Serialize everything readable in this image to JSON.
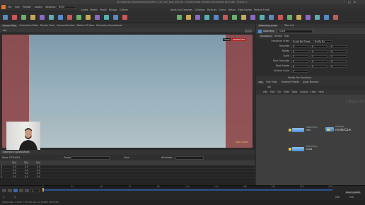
{
  "window": {
    "title": "/ECG/Nordic/Tutorials/Houdini/SHOT_010_040_Rain_v02.hip - Houdini Indie Limited-Commercial 18.0.460 - Python 3"
  },
  "menubar": {
    "items": [
      "File",
      "Edit",
      "Render",
      "Assets",
      "Windows",
      "Help"
    ],
    "desktop": "Build"
  },
  "shelf": {
    "tabs": [
      "Create",
      "Modify",
      "Model",
      "Polygon",
      "Deform",
      "Texture",
      "Rigging",
      "Characters",
      "Constraints",
      "Hair Utils",
      "Terrain FX",
      "Cloud FX",
      "Volume"
    ],
    "fx_tabs": [
      "Lights and Cameras",
      "Collisions",
      "Particles",
      "Grains",
      "Vellum",
      "Rigid Bodies",
      "Particle Fluids",
      "Viscous Fluids",
      "Oceans",
      "Fluid Containers",
      "Populate Containers",
      "Container Tools",
      "Pyro FX",
      "Sparse Pyro FX"
    ]
  },
  "pane_tabs": [
    "Scene View",
    "Animation Editor",
    "Render View",
    "Composite View",
    "Motion FX View",
    "Geometry Spreadsheet"
  ],
  "viewport": {
    "path": "obj",
    "cam_label": "Persp",
    "render_cam": "renderCam",
    "safe_label": "Safe Action"
  },
  "spreadsheet": {
    "tabs": [
      "Geometry Spreadsheet"
    ],
    "node": "Node: PYTHON1",
    "group_label": "Group",
    "view_label": "View",
    "attribs_label": "Attributes",
    "columns": [
      "",
      "P[x]",
      "P[y]",
      "P[z]"
    ],
    "rows": [
      [
        "0",
        "0.0",
        "0.0",
        "0.0"
      ],
      [
        "1",
        "0.0",
        "0.0",
        "0.0"
      ],
      [
        "2",
        "0.0",
        "0.0",
        "0.0"
      ],
      [
        "3",
        "0.0",
        "0.0",
        "0.0"
      ]
    ]
  },
  "timeline": {
    "frame": "1",
    "start": "1",
    "end": "240",
    "ticks": [
      "1",
      "24",
      "48",
      "72",
      "96",
      "120",
      "144",
      "168",
      "192",
      "216",
      "240"
    ],
    "keys_label": "0 keys, 0/0 channels",
    "auto_update": "Auto Update",
    "status": "/obj/snow/: frame 1 of 240  fps: 24  [INDIE EDITION]"
  },
  "params": {
    "tabs": [
      "Geometry snow",
      "Take List"
    ],
    "node_type": "Geometry",
    "node_name": "snow",
    "sub_tabs": [
      "Transform",
      "Render",
      "Misc"
    ],
    "rows": [
      {
        "label": "Transform Order",
        "values": [
          "Scale Rot Trans",
          "Rx Ry Rz"
        ]
      },
      {
        "label": "Translate",
        "values": [
          "0",
          "0",
          "0"
        ]
      },
      {
        "label": "Rotate",
        "values": [
          "0",
          "0",
          "0"
        ]
      },
      {
        "label": "Scale",
        "values": [
          "1",
          "1",
          "1"
        ]
      },
      {
        "label": "Pivot Translate",
        "values": [
          "0",
          "0",
          "0"
        ]
      },
      {
        "label": "Pivot Rotate",
        "values": [
          "0",
          "0",
          "0"
        ]
      },
      {
        "label": "Uniform Scale",
        "values": [
          "1"
        ]
      }
    ],
    "modify_pre_transform": "Modify Pre-Transform"
  },
  "network": {
    "tabs": [
      "obj",
      "Tree View",
      "Material Palette",
      "Asset Browser"
    ],
    "path": "obj",
    "menu": [
      "Add",
      "Edit",
      "Go",
      "View",
      "Tools",
      "Layout",
      "Labs",
      "Help"
    ],
    "title": "Objects",
    "nodes": [
      {
        "type": "Geometry",
        "name": "rain",
        "color": "#4a90d9"
      },
      {
        "type": "Camera",
        "name": "renderCam",
        "color": "#3a7fc4"
      },
      {
        "type": "Geometry",
        "name": "snow",
        "color": "#4a90d9"
      }
    ]
  },
  "colors": {
    "accent": "#e8a020",
    "red_band": "#8c3c3e",
    "sky": "#9bb3bf",
    "node_yellow": "#e6c84a"
  }
}
